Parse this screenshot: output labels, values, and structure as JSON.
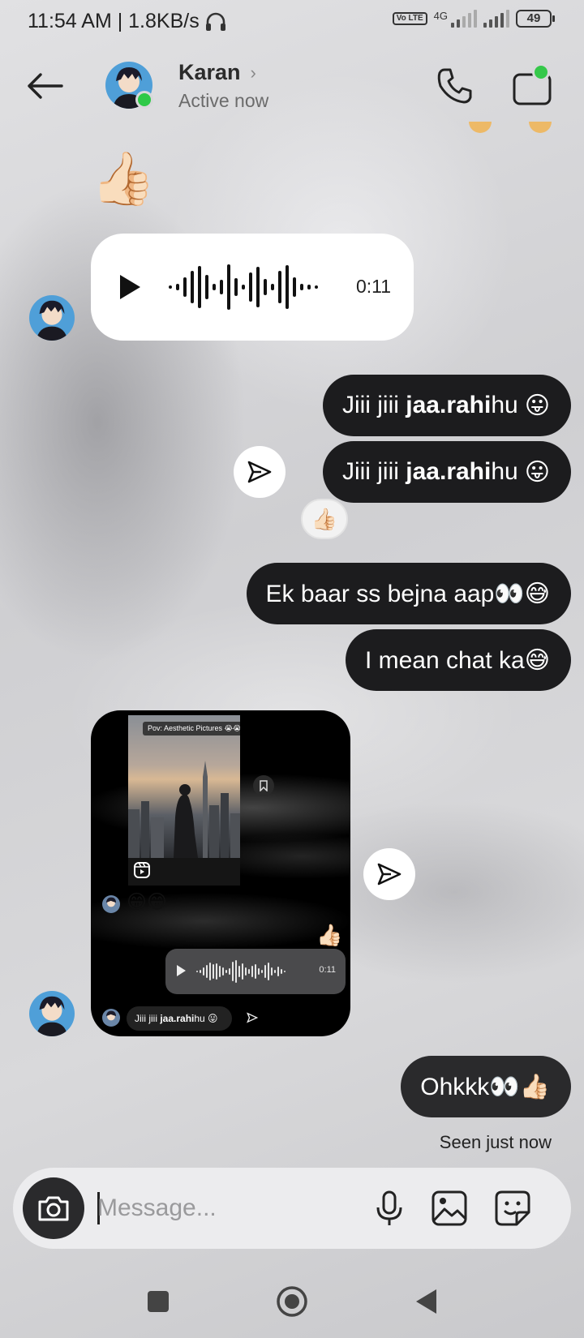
{
  "status_bar": {
    "time_speed": "11:54 AM | 1.8KB/s",
    "volte": "Vo LTE",
    "network": "4G",
    "battery": "49"
  },
  "header": {
    "name": "Karan",
    "status": "Active now"
  },
  "messages": {
    "voice": {
      "duration": "0:11"
    },
    "out1": {
      "pre": "Jiii jiii ",
      "bold": "jaa.rahi",
      "post": " hu",
      "emoji": "😛"
    },
    "out2": {
      "pre": "Jiii jiii ",
      "bold": "jaa.rahi",
      "post": " hu",
      "emoji": "😛"
    },
    "reaction": "👍🏻",
    "out3": {
      "text": "Ek baar ss bejna aap👀😅"
    },
    "out4": {
      "text": "I mean chat ka😅"
    },
    "received_emoji": "👍🏻",
    "shared_screenshot": {
      "reel_caption": "Pov: Aesthetic Pictures 😭😭",
      "emojis": "😁😁",
      "thumb": "👍🏻",
      "voice_time": "0:11",
      "msg_pre": "Jiii jiii ",
      "msg_bold": "jaa.rahi",
      "msg_post": " hu 😛"
    },
    "out5": {
      "text": "Ohkkk👀👍🏻"
    },
    "seen": "Seen just now"
  },
  "composer": {
    "placeholder": "Message..."
  },
  "icons": {
    "back": "arrow-left-icon",
    "call": "phone-icon",
    "video": "video-camera-icon",
    "share": "send-icon",
    "camera": "camera-icon",
    "mic": "microphone-icon",
    "gallery": "image-icon",
    "sticker": "sticker-icon"
  },
  "colors": {
    "bubble_out": "#1c1c1e",
    "online": "#2ec947",
    "background": "#d4d4d6"
  }
}
